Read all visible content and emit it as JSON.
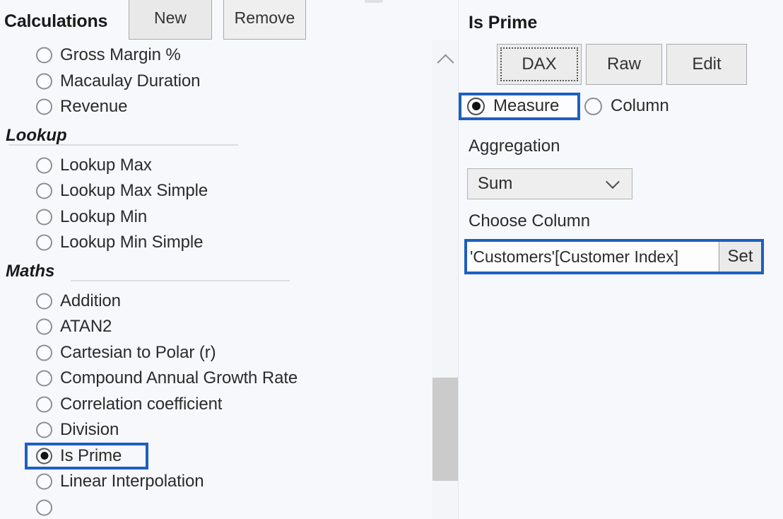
{
  "left": {
    "title": "Calculations",
    "new_label": "New",
    "remove_label": "Remove",
    "ungrouped_items": [
      {
        "label": "Gross Margin %",
        "selected": false
      },
      {
        "label": "Macaulay Duration",
        "selected": false
      },
      {
        "label": "Revenue",
        "selected": false
      }
    ],
    "sections": [
      {
        "heading": "Lookup",
        "items": [
          {
            "label": "Lookup Max",
            "selected": false
          },
          {
            "label": "Lookup Max Simple",
            "selected": false
          },
          {
            "label": "Lookup Min",
            "selected": false
          },
          {
            "label": "Lookup Min Simple",
            "selected": false
          }
        ]
      },
      {
        "heading": "Maths",
        "items": [
          {
            "label": "Addition",
            "selected": false
          },
          {
            "label": "ATAN2",
            "selected": false
          },
          {
            "label": "Cartesian to Polar (r)",
            "selected": false
          },
          {
            "label": "Compound Annual Growth Rate",
            "selected": false
          },
          {
            "label": "Correlation coefficient",
            "selected": false
          },
          {
            "label": "Division",
            "selected": false
          },
          {
            "label": "Is Prime",
            "selected": true
          },
          {
            "label": "Linear Interpolation",
            "selected": false
          }
        ]
      }
    ]
  },
  "right": {
    "title": "Is Prime",
    "tabs": {
      "dax_label": "DAX",
      "raw_label": "Raw",
      "edit_label": "Edit"
    },
    "type_radio": {
      "measure_label": "Measure",
      "column_label": "Column",
      "selected": "Measure"
    },
    "aggregation": {
      "label": "Aggregation",
      "value": "Sum"
    },
    "choose_column": {
      "label": "Choose Column",
      "value": "'Customers'[Customer Index]",
      "placeholder": "",
      "set_label": "Set"
    }
  },
  "colors": {
    "highlight_blue": "#1d5fc0",
    "background": "#f7f8fc",
    "button_face": "#ececec",
    "scrollbar_thumb": "#cbcbcb"
  },
  "icons": {
    "chevron_up": "chevron-up-icon",
    "chevron_down": "chevron-down-icon"
  }
}
